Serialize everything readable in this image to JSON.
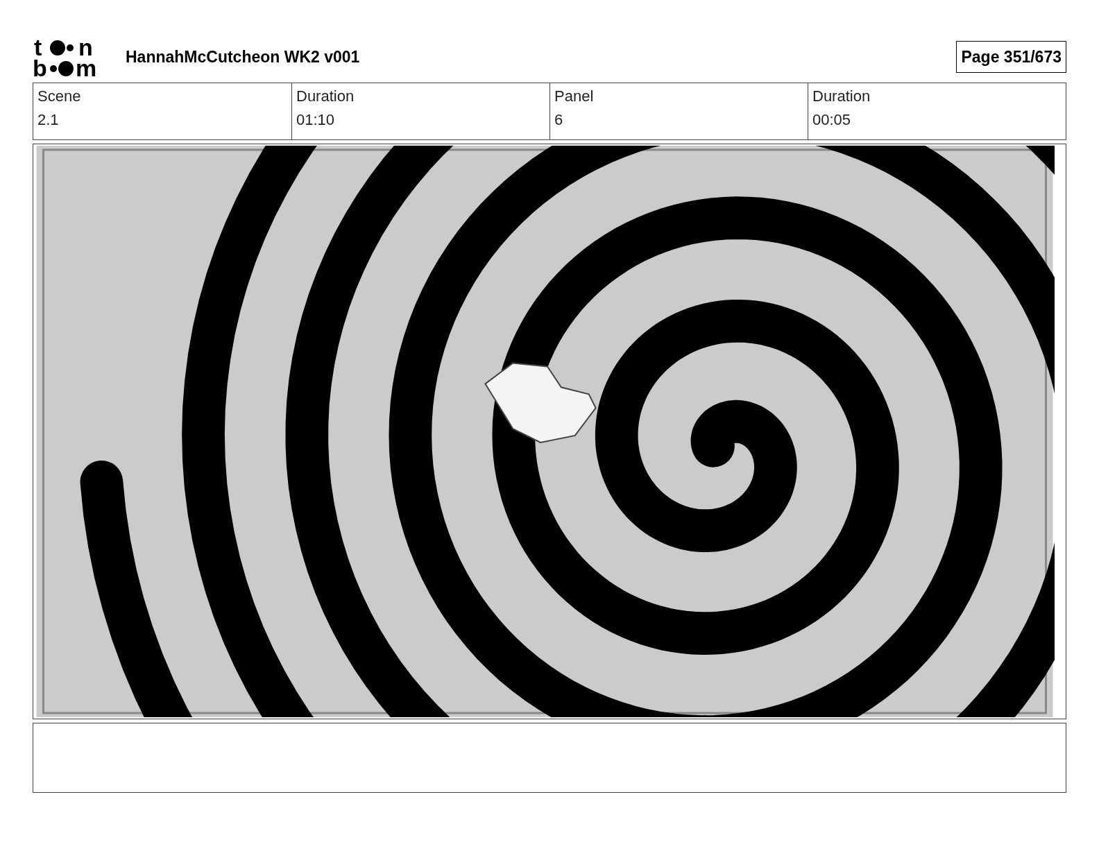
{
  "logo": {
    "top": [
      "t",
      "n"
    ],
    "bottom": [
      "b",
      "m"
    ]
  },
  "title": "HannahMcCutcheon WK2 v001",
  "page": "Page 351/673",
  "fields": [
    {
      "label": "Scene",
      "value": "2.1"
    },
    {
      "label": "Duration",
      "value": "01:10"
    },
    {
      "label": "Panel",
      "value": "6"
    },
    {
      "label": "Duration",
      "value": "00:05"
    }
  ]
}
